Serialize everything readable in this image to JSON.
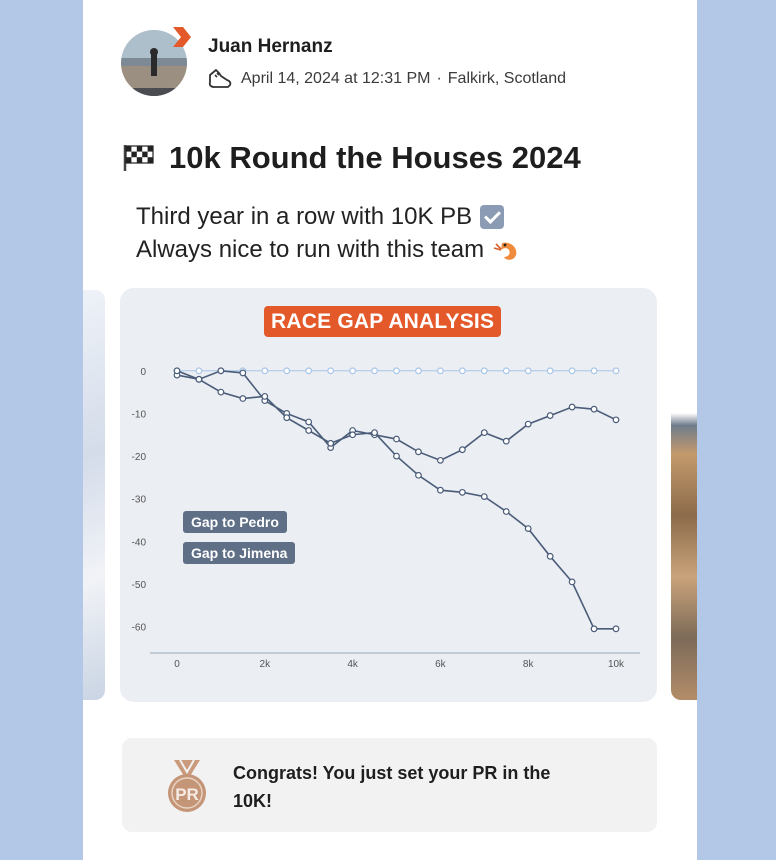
{
  "post": {
    "author": "Juan Hernanz",
    "date": "April 14, 2024 at 12:31 PM",
    "separator": "·",
    "location": "Falkirk, Scotland",
    "title": "10k Round the Houses 2024",
    "description_line1": "Third year in a row with 10K PB",
    "description_line2": "Always nice to run with this team"
  },
  "chart_card": {
    "title": "RACE GAP ANALYSIS",
    "legend": [
      "Gap to Pedro",
      "Gap to Jimena"
    ]
  },
  "achievement": {
    "badge_label": "PR",
    "text": "Congrats! You just set your PR in the 10K!"
  },
  "colors": {
    "accent": "#e4592a",
    "line": "#4a5c78",
    "baseline": "#a9c6e8",
    "legend_bg": "#5f6f86",
    "background": "#b3c8e6"
  },
  "chart_data": {
    "type": "line",
    "title": "RACE GAP ANALYSIS",
    "xlabel": "",
    "ylabel": "",
    "xlim": [
      0,
      10000
    ],
    "ylim": [
      -65,
      3
    ],
    "x_ticks": [
      {
        "value": 0,
        "label": "0"
      },
      {
        "value": 2000,
        "label": "2k"
      },
      {
        "value": 4000,
        "label": "4k"
      },
      {
        "value": 6000,
        "label": "6k"
      },
      {
        "value": 8000,
        "label": "8k"
      },
      {
        "value": 10000,
        "label": "10k"
      }
    ],
    "y_ticks": [
      0,
      -10,
      -20,
      -30,
      -40,
      -50,
      -60
    ],
    "grid": false,
    "series": [
      {
        "name": "",
        "role": "baseline",
        "x": [
          0,
          500,
          1000,
          1500,
          2000,
          2500,
          3000,
          3500,
          4000,
          4500,
          5000,
          5500,
          6000,
          6500,
          7000,
          7500,
          8000,
          8500,
          9000,
          9500,
          10000
        ],
        "values": [
          0,
          0,
          0,
          0,
          0,
          0,
          0,
          0,
          0,
          0,
          0,
          0,
          0,
          0,
          0,
          0,
          0,
          0,
          0,
          0,
          0
        ]
      },
      {
        "name": "",
        "role": "upper",
        "x": [
          0,
          500,
          1000,
          1500,
          2000,
          2500,
          3000,
          3500,
          4000,
          4500,
          5000,
          5500,
          6000,
          6500,
          7000,
          7500,
          8000,
          8500,
          9000,
          9500,
          10000
        ],
        "values": [
          -1,
          -2,
          0,
          -0.5,
          -7,
          -10,
          -12,
          -18,
          -14,
          -15,
          -16,
          -19,
          -21,
          -18.5,
          -14.5,
          -16.5,
          -12.5,
          -10.5,
          -8.5,
          -9,
          -11.5
        ]
      },
      {
        "name": "",
        "role": "lower",
        "x": [
          0,
          500,
          1000,
          1500,
          2000,
          2500,
          3000,
          3500,
          4000,
          4500,
          5000,
          5500,
          6000,
          6500,
          7000,
          7500,
          8000,
          8500,
          9000,
          9500,
          10000
        ],
        "values": [
          0,
          -2,
          -5,
          -6.5,
          -6,
          -11,
          -14,
          -17,
          -15,
          -14.5,
          -20,
          -24.5,
          -28,
          -28.5,
          -29.5,
          -33,
          -37,
          -43.5,
          -49.5,
          -60.5,
          -60.5
        ]
      }
    ]
  }
}
